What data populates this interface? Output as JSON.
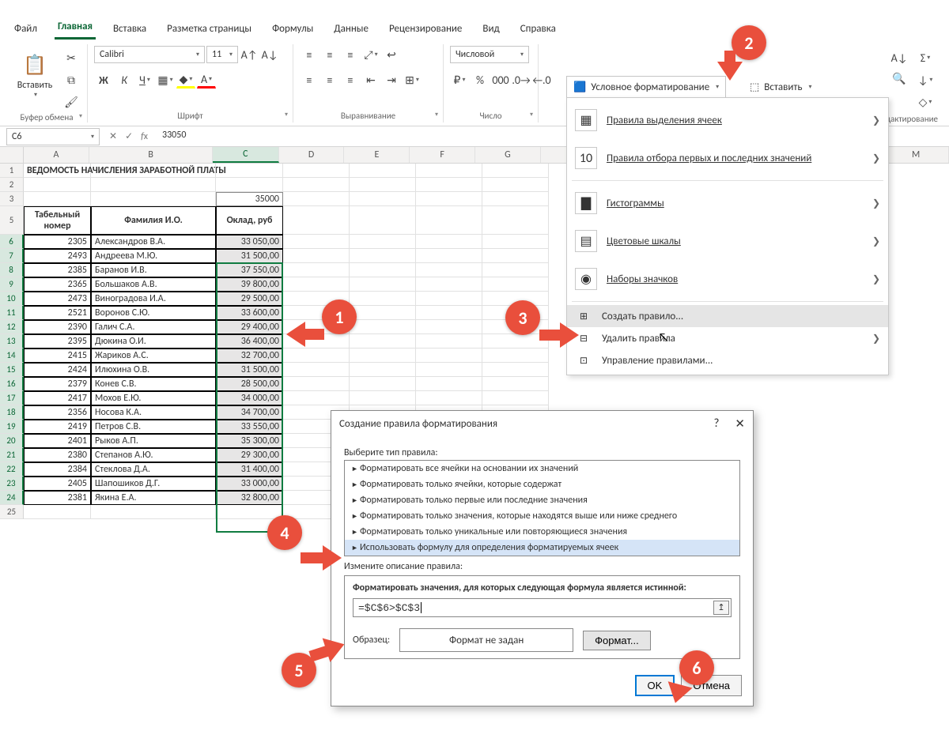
{
  "tabs": [
    "Файл",
    "Главная",
    "Вставка",
    "Разметка страницы",
    "Формулы",
    "Данные",
    "Рецензирование",
    "Вид",
    "Справка"
  ],
  "active_tab": 1,
  "clipboard": {
    "paste": "Вставить",
    "label": "Буфер обмена"
  },
  "font": {
    "label": "Шрифт",
    "name": "Calibri",
    "size": "11"
  },
  "align": {
    "label": "Выравнивание"
  },
  "number": {
    "label": "Число",
    "format": "Числовой"
  },
  "cf_button": "Условное форматирование",
  "insert_button": "Вставить",
  "edit_group_label": "Редактирование",
  "name_box": "C6",
  "formula": "33050",
  "columns": [
    "A",
    "B",
    "C",
    "D",
    "E",
    "F",
    "G",
    "M"
  ],
  "title_cell": "ВЕДОМОСТЬ НАЧИСЛЕНИЯ ЗАРАБОТНОЙ ПЛАТЫ",
  "threshold_cell": "35000",
  "header_row": {
    "a": "Табельный номер",
    "b": "Фамилия И.О.",
    "c": "Оклад, руб"
  },
  "data_rows": [
    {
      "n": "6",
      "a": "2305",
      "b": "Александров В.А.",
      "c": "33 050,00"
    },
    {
      "n": "7",
      "a": "2493",
      "b": "Андреева М.Ю.",
      "c": "31 500,00"
    },
    {
      "n": "8",
      "a": "2385",
      "b": "Баранов И.В.",
      "c": "37 550,00"
    },
    {
      "n": "9",
      "a": "2365",
      "b": "Большаков А.В.",
      "c": "39 800,00"
    },
    {
      "n": "10",
      "a": "2473",
      "b": "Виноградова И.А.",
      "c": "29 500,00"
    },
    {
      "n": "11",
      "a": "2521",
      "b": "Воронов С.Ю.",
      "c": "33 600,00"
    },
    {
      "n": "12",
      "a": "2390",
      "b": "Галич С.А.",
      "c": "29 400,00"
    },
    {
      "n": "13",
      "a": "2395",
      "b": "Дюкина О.И.",
      "c": "36 400,00"
    },
    {
      "n": "14",
      "a": "2415",
      "b": "Жариков А.С.",
      "c": "32 700,00"
    },
    {
      "n": "15",
      "a": "2424",
      "b": "Илюхина О.В.",
      "c": "31 500,00"
    },
    {
      "n": "16",
      "a": "2379",
      "b": "Конев С.В.",
      "c": "28 500,00"
    },
    {
      "n": "17",
      "a": "2417",
      "b": "Мохов Е.Ю.",
      "c": "34 000,00"
    },
    {
      "n": "18",
      "a": "2356",
      "b": "Носова К.А.",
      "c": "34 700,00"
    },
    {
      "n": "19",
      "a": "2419",
      "b": "Петров С.В.",
      "c": "33 550,00"
    },
    {
      "n": "20",
      "a": "2401",
      "b": "Рыков А.П.",
      "c": "35 300,00"
    },
    {
      "n": "21",
      "a": "2380",
      "b": "Степанов А.Ю.",
      "c": "29 300,00"
    },
    {
      "n": "22",
      "a": "2384",
      "b": "Стеклова Д.А.",
      "c": "31 400,00"
    },
    {
      "n": "23",
      "a": "2405",
      "b": "Шапошиков Д.Г.",
      "c": "33 000,00"
    },
    {
      "n": "24",
      "a": "2381",
      "b": "Якина Е.А.",
      "c": "32 800,00"
    }
  ],
  "menu": {
    "highlight_cells": "Правила выделения ячеек",
    "top_bottom": "Правила отбора первых и последних значений",
    "data_bars": "Гистограммы",
    "color_scales": "Цветовые шкалы",
    "icon_sets": "Наборы значков",
    "new_rule": "Создать правило...",
    "clear_rules": "Удалить правила",
    "manage_rules": "Управление правилами..."
  },
  "dialog": {
    "title": "Создание правила форматирования",
    "select_label": "Выберите тип правила:",
    "rules": [
      "Форматировать все ячейки на основании их значений",
      "Форматировать только ячейки, которые содержат",
      "Форматировать только первые или последние значения",
      "Форматировать только значения, которые находятся выше или ниже среднего",
      "Форматировать только уникальные или повторяющиеся значения",
      "Использовать формулу для определения форматируемых ячеек"
    ],
    "edit_label": "Измените описание правила:",
    "formula_label": "Форматировать значения, для которых следующая формула является истинной:",
    "formula_value": "=$C$6>$C$3",
    "sample_label": "Образец:",
    "sample_text": "Формат не задан",
    "format_btn": "Формат...",
    "ok": "OK",
    "cancel": "Отмена"
  },
  "callouts": [
    "1",
    "2",
    "3",
    "4",
    "5",
    "6"
  ]
}
